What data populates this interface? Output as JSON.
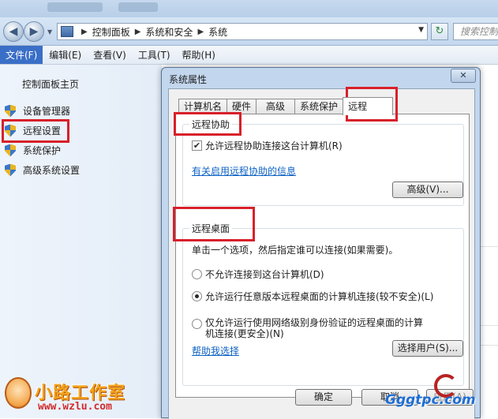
{
  "address_bar": {
    "breadcrumbs": [
      "控制面板",
      "系统和安全",
      "系统"
    ],
    "search_placeholder": "搜索控制面"
  },
  "menu": [
    "文件(F)",
    "编辑(E)",
    "查看(V)",
    "工具(T)",
    "帮助(H)"
  ],
  "menu_active_index": 0,
  "left_pane": {
    "home": "控制面板主页",
    "tasks": [
      "设备管理器",
      "远程设置",
      "系统保护",
      "高级系统设置"
    ]
  },
  "dialog": {
    "title": "系统属性",
    "close": "✕",
    "tabs": [
      "计算机名",
      "硬件",
      "高级",
      "系统保护",
      "远程"
    ],
    "active_tab": "远程",
    "remote_assistance": {
      "legend": "远程协助",
      "checkbox_label": "允许远程协助连接这台计算机(R)",
      "checkbox_checked": true,
      "info_link": "有关启用远程协助的信息",
      "advanced_button": "高级(V)..."
    },
    "remote_desktop": {
      "legend": "远程桌面",
      "instruction": "单击一个选项，然后指定谁可以连接(如果需要)。",
      "options": [
        {
          "label": "不允许连接到这台计算机(D)",
          "selected": false
        },
        {
          "label": "允许运行任意版本远程桌面的计算机连接(较不安全)(L)",
          "selected": true
        },
        {
          "label": "仅允许运行使用网络级别身份验证的远程桌面的计算",
          "label2": "机连接(更安全)(N)",
          "selected": false
        }
      ],
      "help_link": "帮助我选择",
      "select_users_button": "选择用户(S)..."
    },
    "ok_button": "确定",
    "cancel_button": "取消",
    "apply_button": "应用(A)"
  },
  "watermarks": {
    "logo_text": "小路工作室",
    "logo_url": "www.wzlu.com",
    "site_url": "Gggtpc.com"
  },
  "colors": {
    "highlight_box": "#d8202a",
    "link": "#0d62c4",
    "menu_active": "#3a6fc7"
  }
}
